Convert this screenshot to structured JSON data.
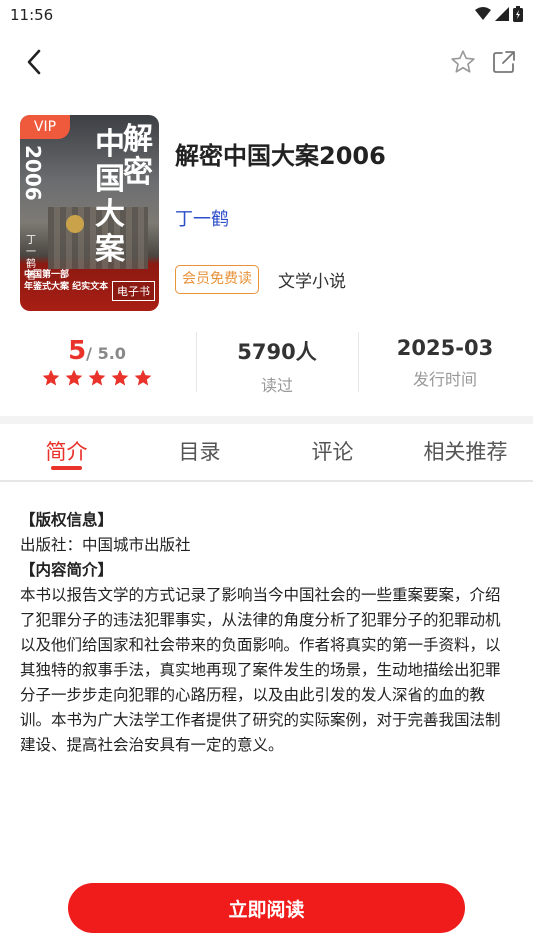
{
  "status_bar": {
    "time": "11:56",
    "icons": [
      "wifi-icon",
      "signal-icon",
      "battery-icon"
    ]
  },
  "nav": {
    "back_icon": "back-arrow-icon",
    "favorite_icon": "star-outline-icon",
    "share_icon": "share-external-icon"
  },
  "book": {
    "cover": {
      "vip_label": "VIP",
      "year_text": "2006",
      "title_col1": "解密",
      "title_col2": "中国大案",
      "author_small": "丁一鹤著",
      "bottom_line1": "中国第一部",
      "bottom_line2": "年鉴式大案 纪实文本",
      "ebook_label": "电子书"
    },
    "title": "解密中国大案2006",
    "author": "丁一鹤",
    "badge": "会员免费读",
    "genre": "文学小说"
  },
  "stats": {
    "rating_value": "5",
    "rating_max": "/ 5.0",
    "stars": 5,
    "readers_value": "5790人",
    "readers_label": "读过",
    "date_value": "2025-03",
    "date_label": "发行时间"
  },
  "tabs": [
    {
      "label": "简介",
      "active": true
    },
    {
      "label": "目录",
      "active": false
    },
    {
      "label": "评论",
      "active": false
    },
    {
      "label": "相关推荐",
      "active": false
    }
  ],
  "intro": {
    "copyright_heading": "【版权信息】",
    "publisher_line": "出版社：中国城市出版社",
    "summary_heading": "【内容简介】",
    "summary_text": "本书以报告文学的方式记录了影响当今中国社会的一些重案要案，介绍了犯罪分子的违法犯罪事实，从法律的角度分析了犯罪分子的犯罪动机以及他们给国家和社会带来的负面影响。作者将真实的第一手资料，以其独特的叙事手法，真实地再现了案件发生的场景，生动地描绘出犯罪分子一步步走向犯罪的心路历程，以及由此引发的发人深省的血的教训。本书为广大法学工作者提供了研究的实际案例，对于完善我国法制建设、提高社会治安具有一定的意义。"
  },
  "actions": {
    "read_now": "立即阅读"
  },
  "colors": {
    "accent": "#e8322a",
    "author_link": "#2c4fc9",
    "badge": "#e8923a",
    "button": "#f01c1c"
  }
}
